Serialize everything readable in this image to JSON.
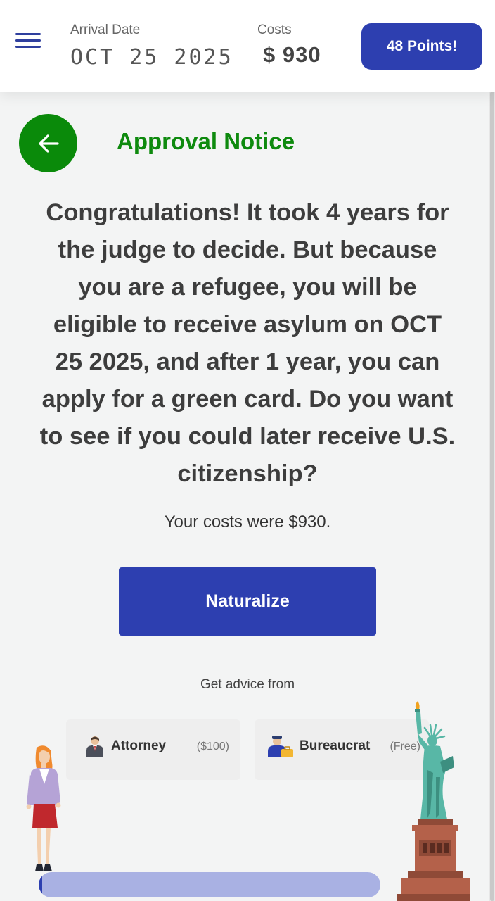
{
  "header": {
    "arrival_label": "Arrival Date",
    "arrival_value": "OCT 25 2025",
    "costs_label": "Costs",
    "costs_value": "$ 930",
    "points_label": "48 Points!"
  },
  "page": {
    "title": "Approval Notice",
    "message": "Congratulations! It took 4 years for the judge to decide. But because you are a refugee, you will be eligible to receive asylum on OCT 25 2025, and after 1 year, you can apply for a green card. Do you want to see if you could later receive U.S. citizenship?",
    "costs_line": "Your costs were $930.",
    "naturalize_label": "Naturalize",
    "advice_label": "Get advice from"
  },
  "advisors": [
    {
      "name": "Attorney",
      "price": "($100)",
      "icon": "attorney-icon"
    },
    {
      "name": "Bureaucrat",
      "price": "(Free)",
      "icon": "bureaucrat-icon"
    }
  ],
  "progress": {
    "fraction": 0.01
  },
  "colors": {
    "primary": "#2d3fb0",
    "success": "#0e8a0e",
    "progress_track": "#a9b1e3",
    "background": "#f3f4f4"
  },
  "icons": {
    "menu": "hamburger-menu-icon",
    "back": "arrow-left-icon",
    "woman": "woman-illustration",
    "statue": "statue-of-liberty-illustration"
  }
}
